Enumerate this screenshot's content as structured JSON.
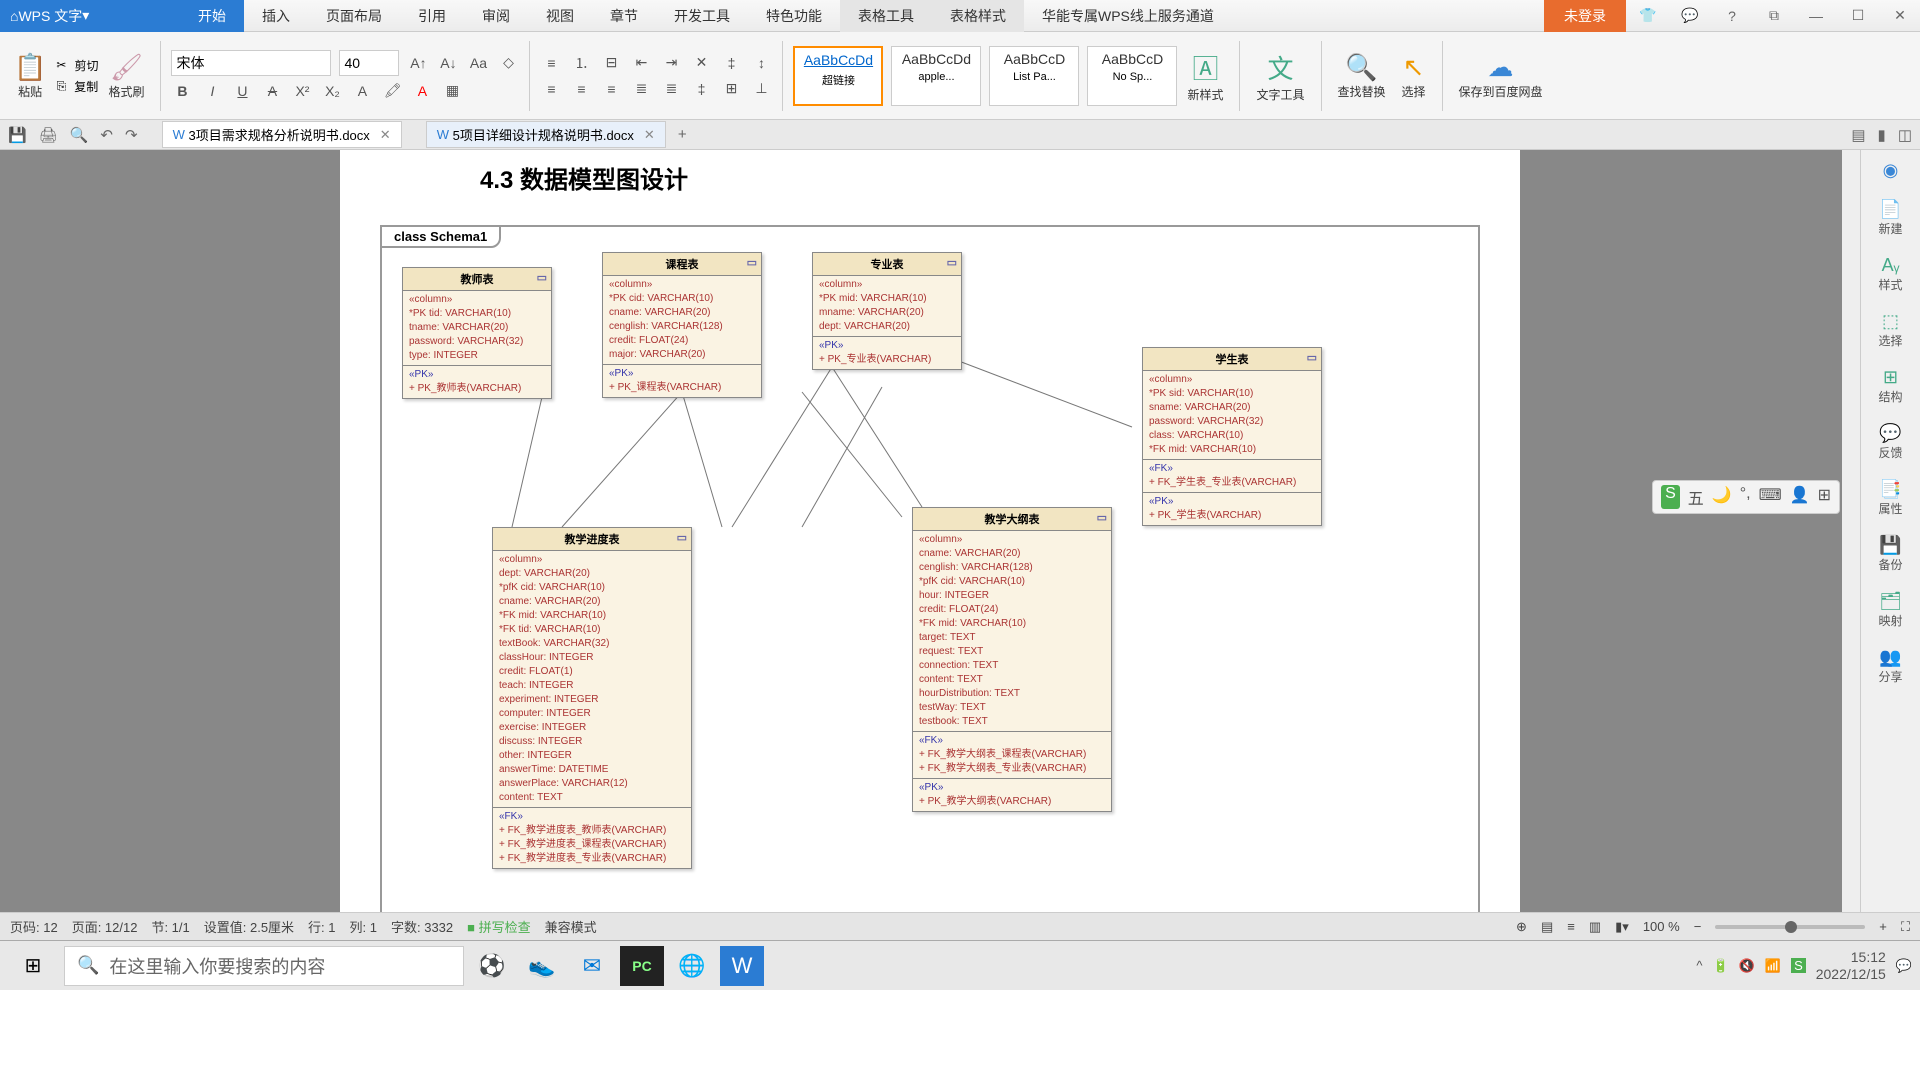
{
  "app": {
    "name": "WPS 文字"
  },
  "menus": [
    "开始",
    "插入",
    "页面布局",
    "引用",
    "审阅",
    "视图",
    "章节",
    "开发工具",
    "特色功能",
    "表格工具",
    "表格样式",
    "华能专属WPS线上服务通道"
  ],
  "login": "未登录",
  "font": {
    "name": "宋体",
    "size": "40"
  },
  "clipboard": {
    "paste": "粘贴",
    "cut": "剪切",
    "copy": "复制",
    "format": "格式刷"
  },
  "styles": [
    {
      "preview": "AaBbCcDd",
      "name": "超链接"
    },
    {
      "preview": "AaBbCcDd",
      "name": "apple..."
    },
    {
      "preview": "AaBbCcD",
      "name": "List Pa..."
    },
    {
      "preview": "AaBbCcD",
      "name": "No Sp..."
    }
  ],
  "ribbon_right": {
    "newstyle": "新样式",
    "texttools": "文字工具",
    "findreplace": "查找替换",
    "select": "选择",
    "savecloud": "保存到百度网盘"
  },
  "tabs": [
    {
      "name": "3项目需求规格分析说明书.docx",
      "active": false
    },
    {
      "name": "5项目详细设计规格说明书.docx",
      "active": true
    }
  ],
  "section": "4.3  数据模型图设计",
  "schema_label": "class Schema1",
  "entities": {
    "teacher": {
      "title": "教师表",
      "cols": [
        "«column»",
        "*PK tid: VARCHAR(10)",
        "   tname: VARCHAR(20)",
        "   password: VARCHAR(32)",
        "   type: INTEGER"
      ],
      "pk": [
        "«PK»",
        "+  PK_教师表(VARCHAR)"
      ]
    },
    "course": {
      "title": "课程表",
      "cols": [
        "«column»",
        "*PK cid: VARCHAR(10)",
        "   cname: VARCHAR(20)",
        "   cenglish: VARCHAR(128)",
        "   credit: FLOAT(24)",
        "   major: VARCHAR(20)"
      ],
      "pk": [
        "«PK»",
        "+  PK_课程表(VARCHAR)"
      ]
    },
    "major": {
      "title": "专业表",
      "cols": [
        "«column»",
        "*PK mid: VARCHAR(10)",
        "   mname: VARCHAR(20)",
        "   dept: VARCHAR(20)"
      ],
      "pk": [
        "«PK»",
        "+  PK_专业表(VARCHAR)"
      ]
    },
    "student": {
      "title": "学生表",
      "cols": [
        "«column»",
        "*PK sid: VARCHAR(10)",
        "   sname: VARCHAR(20)",
        "   password: VARCHAR(32)",
        "   class: VARCHAR(10)",
        "*FK mid: VARCHAR(10)"
      ],
      "fk": [
        "«FK»",
        "+  FK_学生表_专业表(VARCHAR)"
      ],
      "pk": [
        "«PK»",
        "+  PK_学生表(VARCHAR)"
      ]
    },
    "progress": {
      "title": "教学进度表",
      "cols": [
        "«column»",
        "   dept: VARCHAR(20)",
        "*pfK cid: VARCHAR(10)",
        "   cname: VARCHAR(20)",
        "*FK mid: VARCHAR(10)",
        "*FK tid: VARCHAR(10)",
        "   textBook: VARCHAR(32)",
        "   classHour: INTEGER",
        "   credit: FLOAT(1)",
        "   teach: INTEGER",
        "   experiment: INTEGER",
        "   computer: INTEGER",
        "   exercise: INTEGER",
        "   discuss: INTEGER",
        "   other: INTEGER",
        "   answerTime: DATETIME",
        "   answerPlace: VARCHAR(12)",
        "   content: TEXT"
      ],
      "fk": [
        "«FK»",
        "+  FK_教学进度表_教师表(VARCHAR)",
        "+  FK_教学进度表_课程表(VARCHAR)",
        "+  FK_教学进度表_专业表(VARCHAR)"
      ]
    },
    "syllabus": {
      "title": "教学大纲表",
      "cols": [
        "«column»",
        "   cname: VARCHAR(20)",
        "   cenglish: VARCHAR(128)",
        "*pfK cid: VARCHAR(10)",
        "   hour: INTEGER",
        "   credit: FLOAT(24)",
        "*FK mid: VARCHAR(10)",
        "   target: TEXT",
        "   request: TEXT",
        "   connection: TEXT",
        "   content: TEXT",
        "   hourDistribution: TEXT",
        "   testWay: TEXT",
        "   testbook: TEXT"
      ],
      "fk": [
        "«FK»",
        "+  FK_教学大纲表_课程表(VARCHAR)",
        "+  FK_教学大纲表_专业表(VARCHAR)"
      ],
      "pk": [
        "«PK»",
        "+  PK_教学大纲表(VARCHAR)"
      ]
    }
  },
  "sidebar": [
    {
      "ico": "📄",
      "label": "新建"
    },
    {
      "ico": "Aᵧ",
      "label": "样式"
    },
    {
      "ico": "⬚",
      "label": "选择"
    },
    {
      "ico": "📋",
      "label": ""
    },
    {
      "ico": "⊞",
      "label": "结构"
    },
    {
      "ico": "💬",
      "label": "反馈"
    },
    {
      "ico": "📑",
      "label": "属性"
    },
    {
      "ico": "💾",
      "label": "备份"
    },
    {
      "ico": "🗂",
      "label": "映射"
    },
    {
      "ico": "👥",
      "label": "分享"
    }
  ],
  "status": {
    "page": "页码: 12",
    "pages": "页面: 12/12",
    "section": "节: 1/1",
    "ruler": "设置值: 2.5厘米",
    "line": "行: 1",
    "col": "列: 1",
    "words": "字数: 3332",
    "spell": "拼写检查",
    "compat": "兼容模式",
    "zoom": "100 %"
  },
  "taskbar": {
    "search_placeholder": "在这里输入你要搜索的内容",
    "time": "15:12",
    "date": "2022/12/15"
  },
  "ime": {
    "label": "五"
  }
}
